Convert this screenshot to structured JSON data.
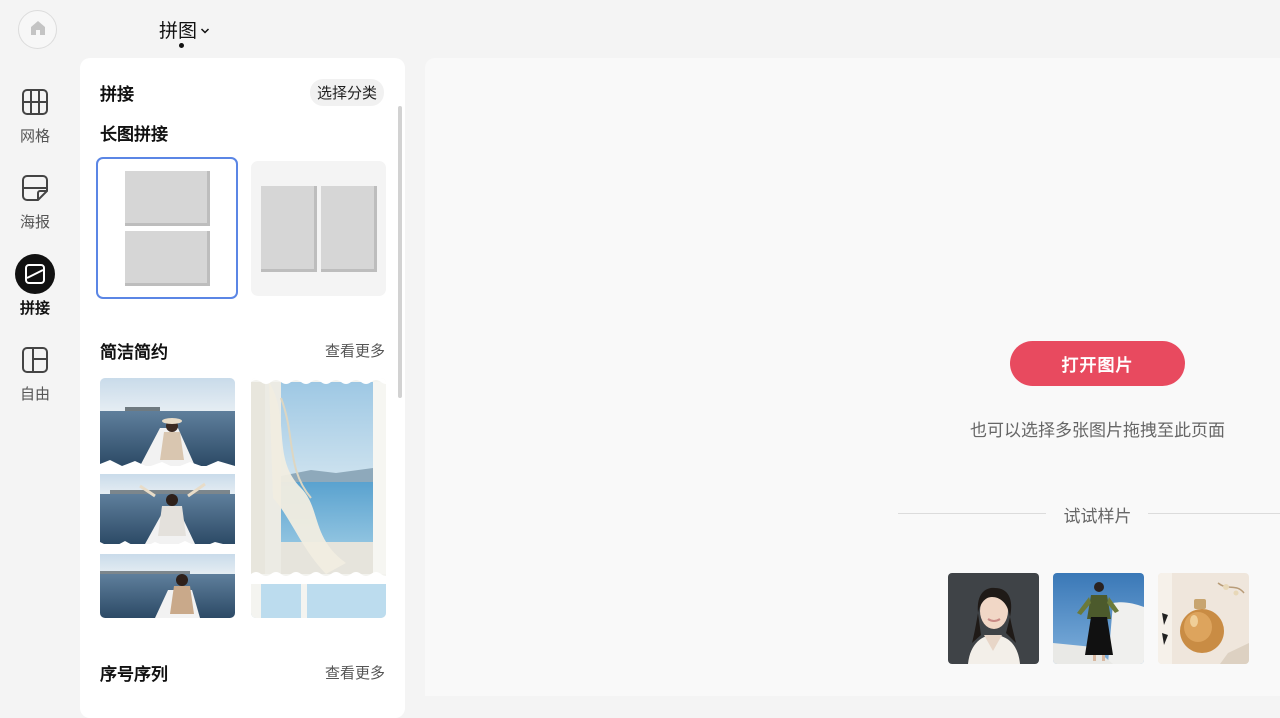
{
  "header": {
    "home_icon": "home-icon",
    "mode_title": "拼图",
    "mode_dropdown_icon": "chevron-down-icon"
  },
  "rail": {
    "items": [
      {
        "label": "网格",
        "icon": "grid-icon",
        "active": false
      },
      {
        "label": "海报",
        "icon": "poster-icon",
        "active": false
      },
      {
        "label": "拼接",
        "icon": "stitch-icon",
        "active": true
      },
      {
        "label": "自由",
        "icon": "free-layout-icon",
        "active": false
      }
    ]
  },
  "panel": {
    "title": "拼接",
    "category_button": "选择分类",
    "sections": [
      {
        "title": "长图拼接",
        "more": ""
      },
      {
        "title": "简洁简约",
        "more": "查看更多"
      },
      {
        "title": "序号序列",
        "more": "查看更多"
      }
    ]
  },
  "canvas": {
    "open_button": "打开图片",
    "drag_hint": "也可以选择多张图片拖拽至此页面",
    "sample_label": "试试样片"
  },
  "colors": {
    "accent": "#e84a5f",
    "selected_border": "#5b86e5",
    "active_rail": "#111111"
  }
}
